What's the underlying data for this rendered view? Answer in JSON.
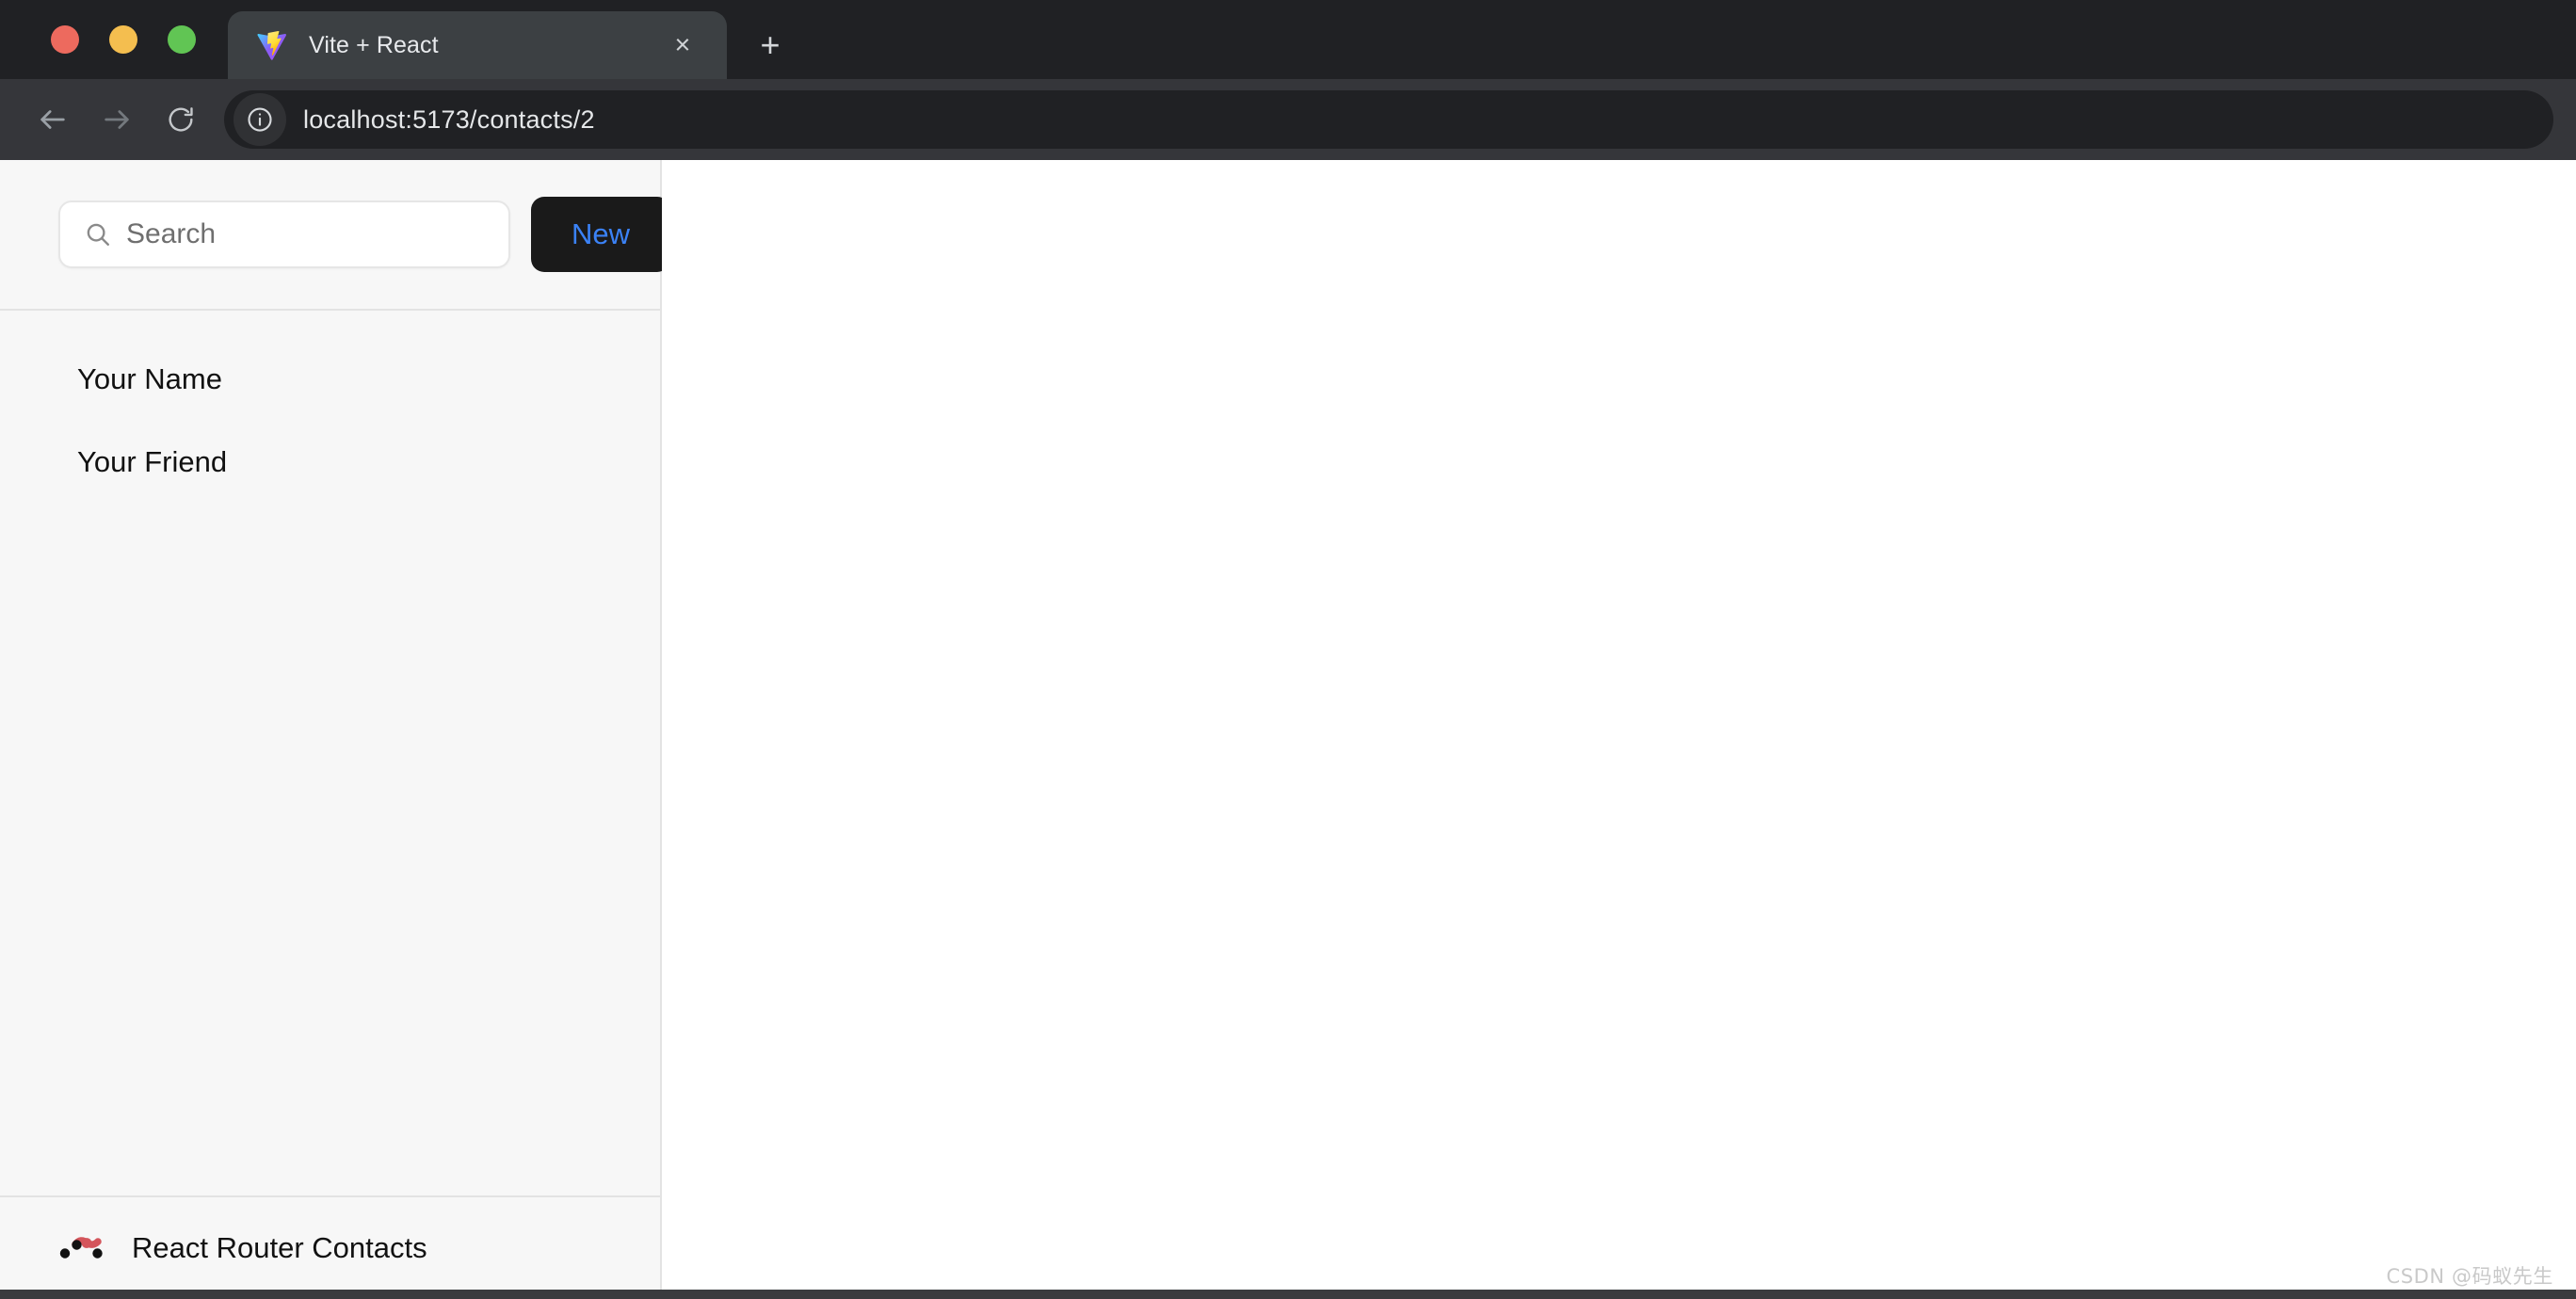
{
  "browser": {
    "traffic_lights": [
      {
        "name": "close",
        "color": "#ED6A5E"
      },
      {
        "name": "minimize",
        "color": "#F4BE4F"
      },
      {
        "name": "maximize",
        "color": "#61C554"
      }
    ],
    "tab": {
      "title": "Vite + React",
      "favicon": "vite-logo-icon",
      "close_label": "×"
    },
    "new_tab_label": "+",
    "toolbar": {
      "back_icon": "back-arrow-icon",
      "forward_icon": "forward-arrow-icon",
      "reload_icon": "reload-icon",
      "site_info_icon": "info-circle-icon",
      "url": "localhost:5173/contacts/2"
    }
  },
  "sidebar": {
    "search": {
      "placeholder": "Search",
      "value": "",
      "icon": "search-icon"
    },
    "new_button_label": "New",
    "contacts": [
      {
        "name": "Your Name"
      },
      {
        "name": "Your Friend"
      }
    ],
    "footer": {
      "logo": "react-router-logo-icon",
      "label": "React Router Contacts"
    }
  },
  "detail": {
    "content": ""
  },
  "watermark": "CSDN @码蚁先生",
  "colors": {
    "chrome_bg": "#202124",
    "toolbar_bg": "#35363a",
    "tab_active_bg": "#3c4043",
    "sidebar_bg": "#f7f7f7",
    "sidebar_border": "#e3e3e3",
    "new_button_bg": "#1a1a1a",
    "new_button_text": "#3b82f6",
    "detail_bg": "#ffffff"
  }
}
